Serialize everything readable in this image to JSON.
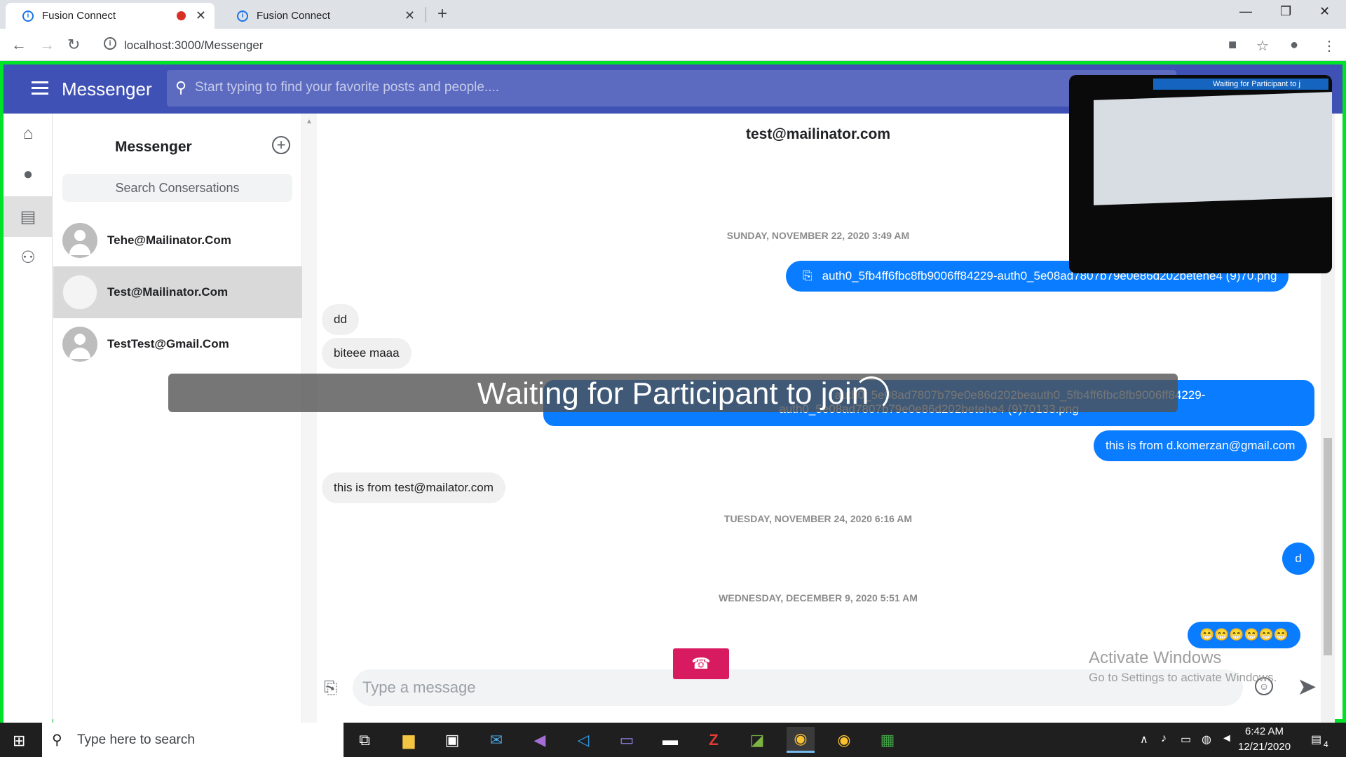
{
  "browser": {
    "tabs": [
      {
        "title": "Fusion Connect"
      },
      {
        "title": "Fusion Connect"
      }
    ],
    "url": "localhost:3000/Messenger"
  },
  "app": {
    "title": "Messenger",
    "search_placeholder": "Start typing to find your favorite posts and people....",
    "accent_color": "#3f51b5"
  },
  "conversations": {
    "heading": "Messenger",
    "search_placeholder": "Search Consersations",
    "items": [
      {
        "name": "Tehe@Mailinator.Com"
      },
      {
        "name": "Test@Mailinator.Com"
      },
      {
        "name": "TestTest@Gmail.Com"
      }
    ]
  },
  "chat": {
    "title": "test@mailinator.com",
    "dates": [
      "SUNDAY, NOVEMBER 22, 2020 3:49 AM",
      "TUESDAY, NOVEMBER 24, 2020 6:16 AM",
      "WEDNESDAY, DECEMBER 9, 2020 5:51 AM"
    ],
    "messages": [
      {
        "dir": "out",
        "text": "auth0_5fb4ff6fbc8fb9006ff84229-auth0_5e08ad7807b79e0e86d202betehe4 (9)70.png"
      },
      {
        "dir": "in",
        "text": "dd"
      },
      {
        "dir": "in",
        "text": "biteee maaa"
      },
      {
        "dir": "out",
        "text": "auth0_5e08ad7807b79e0e86d202beauth0_5fb4ff6fbc8fb9006ff84229-"
      },
      {
        "dir": "out",
        "text": "auth0_5e08ad7807b79e0e86d202betehe4 (9)70133.png"
      },
      {
        "dir": "out",
        "text": "this is from d.komerzan@gmail.com"
      },
      {
        "dir": "in",
        "text": "this is from test@mailator.com"
      },
      {
        "dir": "out",
        "text": "d"
      },
      {
        "dir": "out",
        "text": "😁😁😁😁😁😁"
      }
    ],
    "compose_placeholder": "Type a message"
  },
  "call": {
    "waiting_text": "Waiting for Participant to join",
    "pip_text": "Waiting for Participant to j"
  },
  "watermark": {
    "line1": "Activate Windows",
    "line2": "Go to Settings to activate Windows."
  },
  "taskbar": {
    "search_placeholder": "Type here to search",
    "time": "6:42 AM",
    "date": "12/21/2020",
    "notification_count": "4"
  }
}
